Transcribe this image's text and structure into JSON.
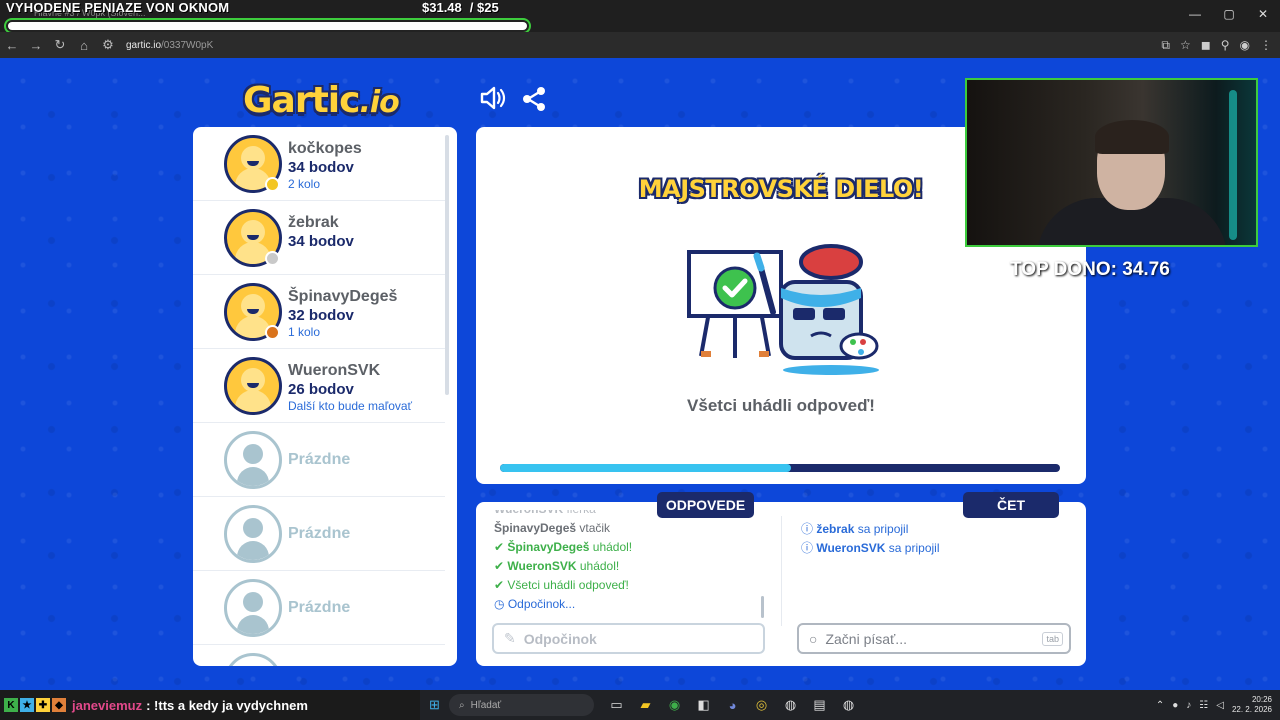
{
  "stream_overlay": {
    "title": "VYHODENE PENIAZE VON OKNOM",
    "money_current": "$31.48",
    "money_goal": "/ $25",
    "goal_progress": 1.0,
    "donation": "TOP DONO: 34.76"
  },
  "browser": {
    "tab_title": "Hlavné #3 / W0pk (Sloven...",
    "url_host": "gartic.io",
    "url_path": "/0337W0pK"
  },
  "game": {
    "logo_main": "Gartic",
    "logo_suffix": ".io",
    "players": [
      {
        "name": "kočkopes",
        "score": "34 bodov",
        "status": "2 kolo",
        "dot_color": "#f3c623"
      },
      {
        "name": "žebrak",
        "score": "34 bodov",
        "status": "",
        "dot_color": "#c9c9c9"
      },
      {
        "name": "ŠpinavyDegeš",
        "score": "32 bodov",
        "status": "1 kolo",
        "dot_color": "#d9731c"
      },
      {
        "name": "WueronSVK",
        "score": "26 bodov",
        "status": "Další kto bude maľovať",
        "dot_color": ""
      }
    ],
    "empty_slots": [
      "Prázdne",
      "Prázdne",
      "Prázdne"
    ],
    "headline": "MAJSTROVSKÉ DIELO!",
    "subtitle": "Všetci uhádli odpoveď!",
    "round_progress": 0.52,
    "answers_tab": "ODPOVEDE",
    "chat_tab": "ČET",
    "answers": [
      {
        "who": "WueronSVK",
        "text": "fierka",
        "style": "fade",
        "icon": ""
      },
      {
        "who": "ŠpinavyDegeš",
        "text": "vtačik",
        "style": "gray",
        "icon": ""
      },
      {
        "who": "ŠpinavyDegeš",
        "text": "uhádol!",
        "style": "green",
        "icon": "✔"
      },
      {
        "who": "WueronSVK",
        "text": "uhádol!",
        "style": "green",
        "icon": "✔"
      },
      {
        "who": "",
        "text": "Všetci uhádli odpoveď!",
        "style": "green",
        "icon": "✔"
      },
      {
        "who": "",
        "text": "Odpočinok...",
        "style": "blue",
        "icon": "◷"
      }
    ],
    "chat": [
      {
        "who": "žebrak",
        "text": "sa pripojil"
      },
      {
        "who": "WueronSVK",
        "text": "sa pripojil"
      }
    ],
    "answer_input_placeholder": "Odpočinok",
    "chat_input_placeholder": "Začni písať...",
    "chat_input_key": "tab"
  },
  "stream_chat": {
    "user": "janeviemuz",
    "message": ": !tts a kedy ja vydychnem"
  },
  "taskbar": {
    "search_placeholder": "Hľadať",
    "time": "20:26",
    "date": "22. 2. 2026"
  }
}
